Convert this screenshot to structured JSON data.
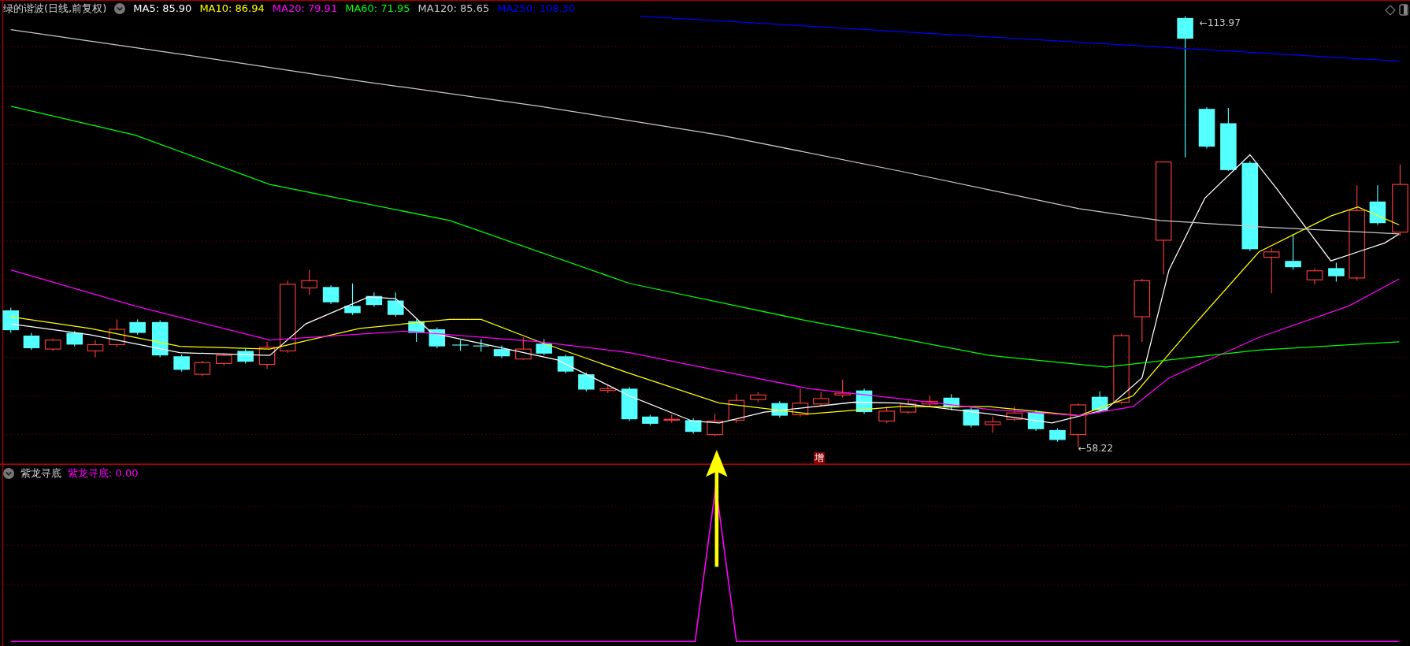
{
  "main_panel": {
    "title": "绿的谐波(日线,前复权)",
    "indicators": [
      {
        "label": "MA5: 85.90",
        "color": "#ffffff"
      },
      {
        "label": "MA10: 86.94",
        "color": "#ffff00"
      },
      {
        "label": "MA20: 79.91",
        "color": "#ff00ff"
      },
      {
        "label": "MA60: 71.95",
        "color": "#00ff00"
      },
      {
        "label": "MA120: 85.65",
        "color": "#c8c8c8"
      },
      {
        "label": "MA250: 108.30",
        "color": "#0000ff"
      }
    ],
    "high_label": "←113.97",
    "low_label": "←58.22",
    "marker": "增"
  },
  "sub_panel": {
    "title": "紫龙寻底",
    "indicators": [
      {
        "label": "紫龙寻底: 0.00",
        "color": "#ff00ff"
      }
    ]
  }
}
